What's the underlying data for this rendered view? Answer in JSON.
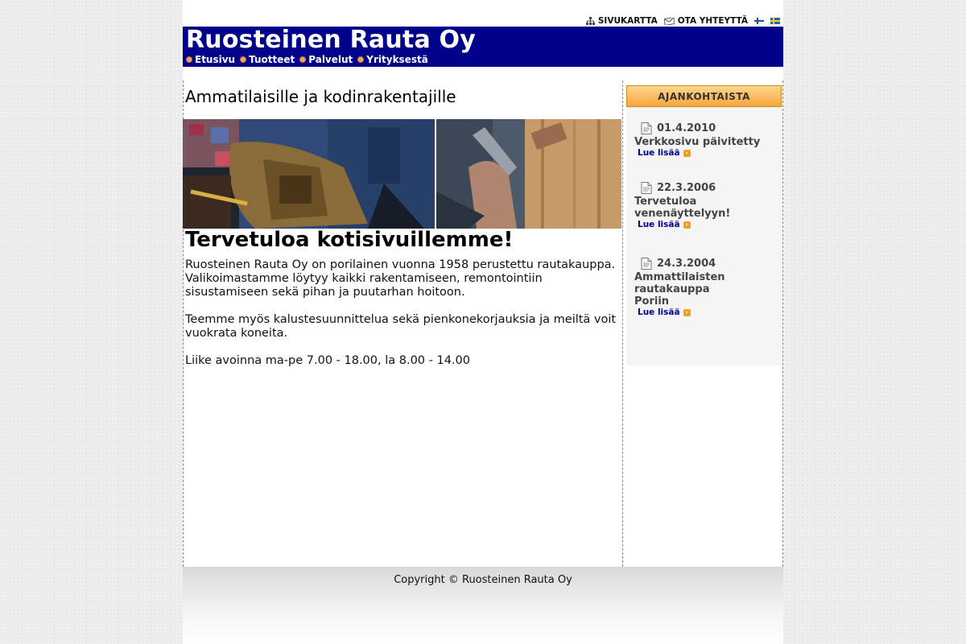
{
  "top_links": {
    "sitemap": "SIVUKARTTA",
    "contact": "OTA YHTEYTTÄ"
  },
  "header": {
    "title": "Ruosteinen Rauta Oy",
    "nav": [
      "Etusivu",
      "Tuotteet",
      "Palvelut",
      "Yrityksestä"
    ]
  },
  "main": {
    "subtitle": "Ammatilaisille ja kodinrakentajille",
    "welcome": "Tervetuloa kotisivuillemme!",
    "paragraphs": [
      "Ruosteinen Rauta Oy on porilainen vuonna 1958 perustettu rautakauppa. Valikoimastamme löytyy kaikki rakentamiseen, remontointiin sisustamiseen sekä pihan ja puutarhan hoitoon.",
      "Teemme myös kalustesuunnittelua sekä pienkonekorjauksia ja meiltä voit vuokrata koneita.",
      "Liike avoinna ma-pe 7.00 - 18.00, la 8.00 - 14.00"
    ]
  },
  "sidebar": {
    "header": "AJANKOHTAISTA",
    "news": [
      {
        "date": "01.4.2010",
        "title": "Verkkosivu päivitetty",
        "more": "Lue lisää"
      },
      {
        "date": "22.3.2006",
        "title": "Tervetuloa venenäyttelyyn!",
        "more": "Lue lisää"
      },
      {
        "date": "24.3.2004",
        "title": "Ammattilaisten rautakauppa Poriin",
        "more": "Lue lisää"
      }
    ]
  },
  "footer": {
    "copyright": "Copyright © Ruosteinen Rauta Oy"
  },
  "colors": {
    "header_bg": "#00008b",
    "news_header": "#f6a73a",
    "nav_dot": "#f0a060"
  }
}
